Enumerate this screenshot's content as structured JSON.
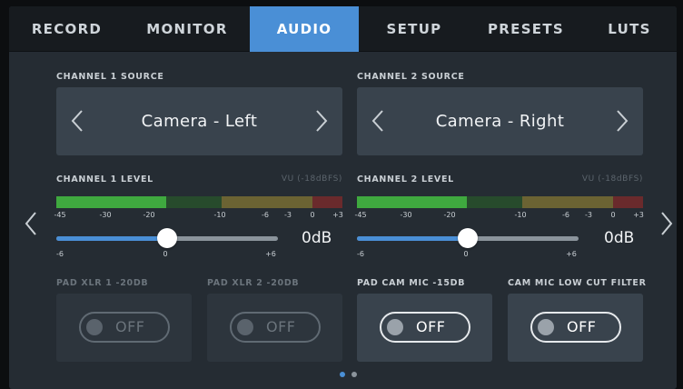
{
  "tabs": [
    {
      "label": "RECORD",
      "active": false
    },
    {
      "label": "MONITOR",
      "active": false
    },
    {
      "label": "AUDIO",
      "active": true
    },
    {
      "label": "SETUP",
      "active": false
    },
    {
      "label": "PRESETS",
      "active": false
    },
    {
      "label": "LUTS",
      "active": false
    }
  ],
  "channel1": {
    "source_label": "CHANNEL 1 SOURCE",
    "source_value": "Camera - Left",
    "level_label": "CHANNEL 1 LEVEL",
    "vu_label": "VU (-18dBFS)",
    "gain_value": "0dB"
  },
  "channel2": {
    "source_label": "CHANNEL 2 SOURCE",
    "source_value": "Camera - Right",
    "level_label": "CHANNEL 2 LEVEL",
    "vu_label": "VU (-18dBFS)",
    "gain_value": "0dB"
  },
  "meter_ticks": [
    "-45",
    "-30",
    "-20",
    "-10",
    "-6",
    "-3",
    "0",
    "+3"
  ],
  "slider_ticks": [
    "-6",
    "0",
    "+6"
  ],
  "slider_level_fraction": 0.5,
  "toggles": [
    {
      "label": "PAD XLR 1 -20DB",
      "state": "OFF",
      "enabled": false
    },
    {
      "label": "PAD XLR 2 -20DB",
      "state": "OFF",
      "enabled": false
    },
    {
      "label": "PAD CAM MIC -15DB",
      "state": "OFF",
      "enabled": true
    },
    {
      "label": "CAM MIC LOW CUT FILTER",
      "state": "OFF",
      "enabled": true
    }
  ],
  "pagination": {
    "current_page": 1,
    "total_pages": 2
  },
  "icons": {
    "prev": "chevron-left-icon",
    "next": "chevron-right-icon"
  },
  "colors": {
    "accent": "#4a8fd6",
    "meter_green": "#3fa93f",
    "meter_green_dim": "#274b2c",
    "meter_yellow": "#6b6333",
    "meter_red": "#6a2a2c"
  }
}
